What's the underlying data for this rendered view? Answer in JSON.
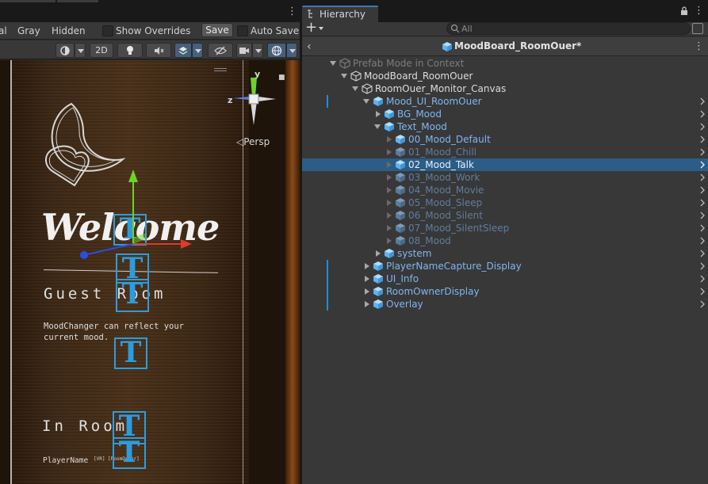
{
  "scene": {
    "toolbar1": {
      "partial_tab_label": "al",
      "gray_label": "Gray",
      "hidden_label": "Hidden",
      "show_overrides_label": "Show Overrides",
      "save_label": "Save",
      "auto_save_label": "Auto Save"
    },
    "toolbar2": {
      "mode_2d_label": "2D"
    },
    "viewport": {
      "welcome": "Welcome",
      "guest_room": "Guest Room",
      "mood_description": "MoodChanger can reflect your\ncurrent mood.",
      "in_room": "In Room",
      "player_name": "PlayerName",
      "player_tags": "[VR] [RoomOwner]",
      "t_glyph": "T",
      "projection_label": "Persp",
      "axis_y": "y",
      "axis_z": "z"
    }
  },
  "hierarchy": {
    "tab_label": "Hierarchy",
    "search": {
      "placeholder": "All"
    },
    "prefab_title": "MoodBoard_RoomOuer*",
    "colors": {
      "prefab_blue": "#7fb6f0",
      "selection": "#2c5d87",
      "override_bar": "#1e8fd6"
    },
    "rows": [
      {
        "label": "Prefab Mode in Context",
        "style": "context",
        "icon": "prefab-outline-icon",
        "fold": "expanded",
        "indent": 0,
        "chevron": false,
        "override": false,
        "selected": false
      },
      {
        "label": "MoodBoard_RoomOuer",
        "style": "root",
        "icon": "prefab-outline-icon",
        "fold": "expanded",
        "indent": 1,
        "chevron": false,
        "override": false,
        "selected": false
      },
      {
        "label": "RoomOuer_Monitor_Canvas",
        "style": "root",
        "icon": "prefab-outline-icon",
        "fold": "expanded",
        "indent": 2,
        "chevron": false,
        "override": false,
        "selected": false
      },
      {
        "label": "Mood_UI_RoomOuer",
        "style": "prefab",
        "icon": "prefab-cube-icon",
        "fold": "expanded",
        "indent": 3,
        "chevron": true,
        "override": true,
        "selected": false
      },
      {
        "label": "BG_Mood",
        "style": "prefab",
        "icon": "prefab-cube-icon",
        "fold": "collapsed",
        "indent": 4,
        "chevron": true,
        "override": false,
        "selected": false
      },
      {
        "label": "Text_Mood",
        "style": "prefab",
        "icon": "prefab-cube-icon",
        "fold": "expanded",
        "indent": 4,
        "chevron": true,
        "override": false,
        "selected": false
      },
      {
        "label": "00_Mood_Default",
        "style": "prefab",
        "icon": "prefab-cube-icon",
        "fold": "collapsed-dim",
        "indent": 5,
        "chevron": true,
        "override": false,
        "selected": false
      },
      {
        "label": "01_Mood_Chill",
        "style": "dim",
        "icon": "prefab-cube-icon",
        "fold": "collapsed-dim",
        "indent": 5,
        "chevron": true,
        "override": false,
        "selected": false
      },
      {
        "label": "02_Mood_Talk",
        "style": "selected",
        "icon": "prefab-cube-icon",
        "fold": "collapsed-dim",
        "indent": 5,
        "chevron": true,
        "override": false,
        "selected": true
      },
      {
        "label": "03_Mood_Work",
        "style": "dim",
        "icon": "prefab-cube-icon",
        "fold": "collapsed-dim",
        "indent": 5,
        "chevron": true,
        "override": false,
        "selected": false
      },
      {
        "label": "04_Mood_Movie",
        "style": "dim",
        "icon": "prefab-cube-icon",
        "fold": "collapsed-dim",
        "indent": 5,
        "chevron": true,
        "override": false,
        "selected": false
      },
      {
        "label": "05_Mood_Sleep",
        "style": "dim",
        "icon": "prefab-cube-icon",
        "fold": "collapsed-dim",
        "indent": 5,
        "chevron": true,
        "override": false,
        "selected": false
      },
      {
        "label": "06_Mood_Silent",
        "style": "dim",
        "icon": "prefab-cube-icon",
        "fold": "collapsed-dim",
        "indent": 5,
        "chevron": true,
        "override": false,
        "selected": false
      },
      {
        "label": "07_Mood_SilentSleep",
        "style": "dim",
        "icon": "prefab-cube-icon",
        "fold": "collapsed-dim",
        "indent": 5,
        "chevron": true,
        "override": false,
        "selected": false
      },
      {
        "label": "08_Mood",
        "style": "dim",
        "icon": "prefab-cube-icon",
        "fold": "collapsed-dim",
        "indent": 5,
        "chevron": true,
        "override": false,
        "selected": false
      },
      {
        "label": "system",
        "style": "prefab",
        "icon": "prefab-cube-icon",
        "fold": "collapsed",
        "indent": 4,
        "chevron": true,
        "override": false,
        "selected": false
      },
      {
        "label": "PlayerNameCapture_Display",
        "style": "prefab",
        "icon": "prefab-cube-icon",
        "fold": "collapsed",
        "indent": 3,
        "chevron": true,
        "override": true,
        "selected": false
      },
      {
        "label": "UI_Info",
        "style": "prefab",
        "icon": "prefab-cube-icon",
        "fold": "collapsed",
        "indent": 3,
        "chevron": true,
        "override": true,
        "selected": false
      },
      {
        "label": "RoomOwnerDisplay",
        "style": "prefab",
        "icon": "prefab-cube-icon",
        "fold": "collapsed",
        "indent": 3,
        "chevron": true,
        "override": true,
        "selected": false
      },
      {
        "label": "Overlay",
        "style": "prefab",
        "icon": "prefab-cube-icon",
        "fold": "collapsed",
        "indent": 3,
        "chevron": true,
        "override": true,
        "selected": false
      }
    ]
  }
}
